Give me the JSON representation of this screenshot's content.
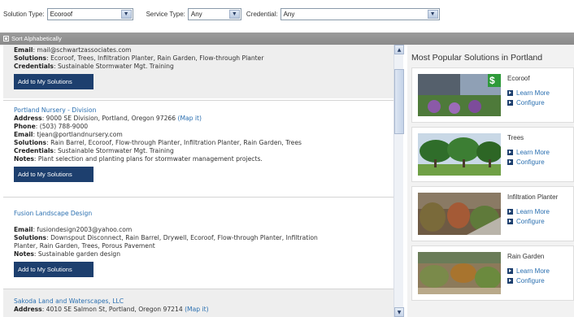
{
  "filters": {
    "solution_type_label": "Solution Type:",
    "solution_type_value": "Ecoroof",
    "service_type_label": "Service Type:",
    "service_type_value": "Any",
    "credential_label": "Credential:",
    "credential_value": "Any"
  },
  "sort": {
    "label": "Sort Alphabetically"
  },
  "results": [
    {
      "email_label": "Email",
      "email": "mail@schwartzassociates.com",
      "solutions_label": "Solutions",
      "solutions": "Ecoroof, Trees, Infiltration Planter, Rain Garden, Flow-through Planter",
      "credentials_label": "Credentials",
      "credentials": "Sustainable Stormwater Mgt. Training",
      "button": "Add to My Solutions"
    },
    {
      "name": "Portland Nursery - Division",
      "address_label": "Address",
      "address": "9000 SE Division, Portland, Oregon 97266",
      "map_link": "(Map it)",
      "phone_label": "Phone",
      "phone": "(503) 788-9000",
      "email_label": "Email",
      "email": "tjean@portlandnursery.com",
      "solutions_label": "Solutions",
      "solutions": "Rain Barrel, Ecoroof, Flow-through Planter, Infiltration Planter, Rain Garden, Trees",
      "credentials_label": "Credentials",
      "credentials": "Sustainable Stormwater Mgt. Training",
      "notes_label": "Notes",
      "notes": "Plant selection and planting plans for stormwater management projects.",
      "button": "Add to My Solutions"
    },
    {
      "name": "Fusion Landscape Design",
      "email_label": "Email",
      "email": "fusiondesign2003@yahoo.com",
      "solutions_label": "Solutions",
      "solutions_line1": "Downspout Disconnect, Rain Barrel, Drywell, Ecoroof, Flow-through Planter, Infiltration",
      "solutions_line2": "Planter, Rain Garden, Trees, Porous Pavement",
      "notes_label": "Notes",
      "notes": "Sustainable garden design",
      "button": "Add to My Solutions"
    },
    {
      "name": "Sakoda Land and Waterscapes, LLC",
      "address_label": "Address",
      "address": "4010 SE Salmon St, Portland, Oregon 97214",
      "map_link": "(Map it)"
    }
  ],
  "sidebar": {
    "title": "Most Popular Solutions in Portland",
    "solutions": [
      {
        "name": "Ecoroof",
        "learn": "Learn More",
        "configure": "Configure",
        "badge": "$"
      },
      {
        "name": "Trees",
        "learn": "Learn More",
        "configure": "Configure"
      },
      {
        "name": "Infiltration Planter",
        "learn": "Learn More",
        "configure": "Configure"
      },
      {
        "name": "Rain Garden",
        "learn": "Learn More",
        "configure": "Configure"
      }
    ]
  }
}
